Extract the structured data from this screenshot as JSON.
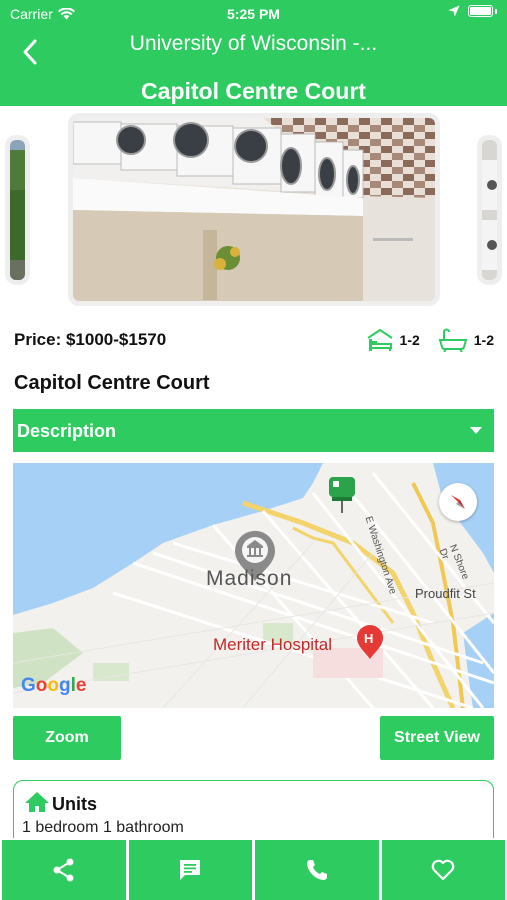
{
  "status_bar": {
    "carrier": "Carrier",
    "time": "5:25 PM"
  },
  "header": {
    "nav_title": "University of Wisconsin -...",
    "page_title": "Capitol Centre Court"
  },
  "listing": {
    "price": "Price: $1000-$1570",
    "bedrooms": "1-2",
    "bathrooms": "1-2",
    "name": "Capitol Centre Court"
  },
  "description": {
    "label": "Description"
  },
  "map": {
    "city_label": "Madison",
    "hospital_label": "Meriter Hospital",
    "street_proudfit": "Proudfit St",
    "street_washington": "E Washington Ave",
    "street_shore": "N Shore Dr",
    "attribution": "Google"
  },
  "buttons": {
    "zoom": "Zoom",
    "street_view": "Street View"
  },
  "units": {
    "title": "Units",
    "first_line": "1 bedroom 1 bathroom"
  },
  "colors": {
    "accent": "#2ecc60",
    "water": "#a6d0f5",
    "hospital": "#e53935"
  },
  "icons": {
    "bottom_bar": [
      "share-icon",
      "message-icon",
      "phone-icon",
      "heart-icon"
    ]
  }
}
